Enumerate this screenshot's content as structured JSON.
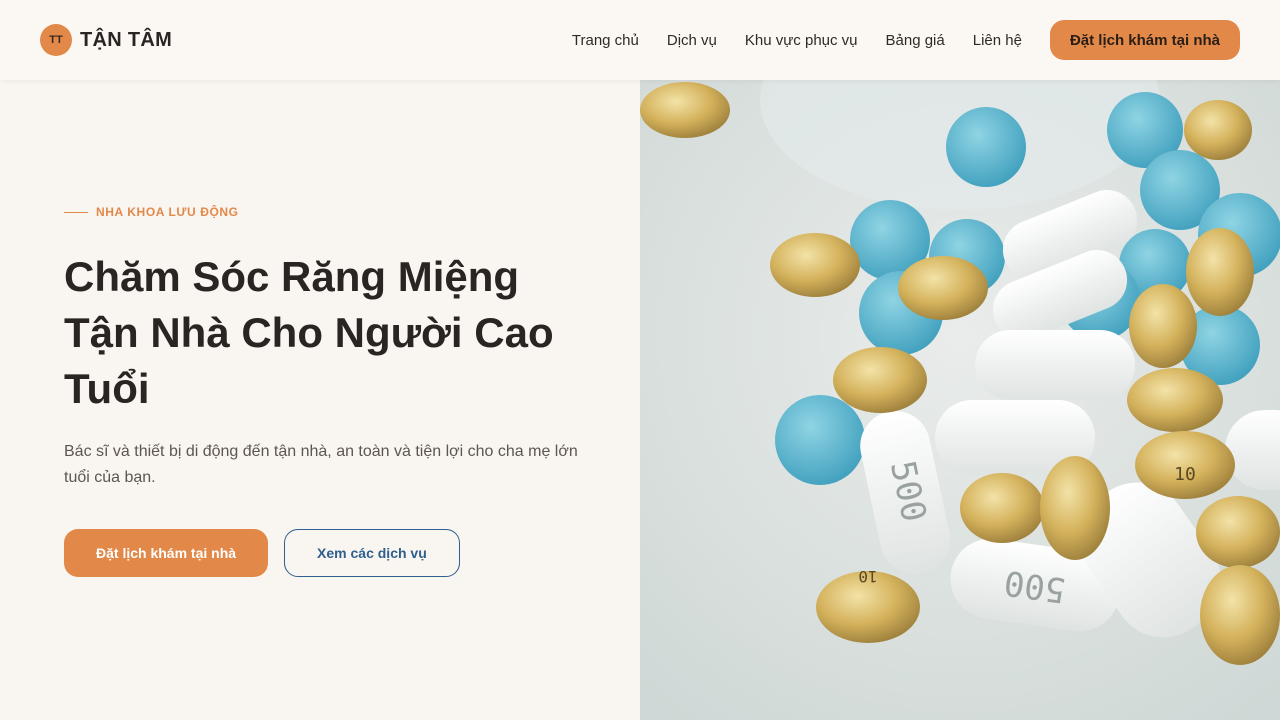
{
  "brand": {
    "initials": "TT",
    "name": "TẬN TÂM"
  },
  "nav": {
    "links": [
      "Trang chủ",
      "Dịch vụ",
      "Khu vực phục vụ",
      "Bảng giá",
      "Liên hệ"
    ],
    "cta_label": "Đặt lịch khám tại nhà"
  },
  "hero": {
    "eyebrow": "NHA KHOA LƯU ĐỘNG",
    "title": "Chăm Sóc Răng Miệng Tận Nhà Cho Người Cao Tuổi",
    "subtitle": "Bác sĩ và thiết bị di động đến tận nhà, an toàn và tiện lợi cho cha mẹ lớn tuổi của bạn.",
    "primary_button": "Đặt lịch khám tại nhà",
    "secondary_button": "Xem các dịch vụ"
  },
  "image": {
    "pill_label_500": "500",
    "pill_label_10": "10"
  },
  "colors": {
    "accent": "#e2894a",
    "secondary": "#2f5f8e",
    "background": "#f9f5f0"
  }
}
